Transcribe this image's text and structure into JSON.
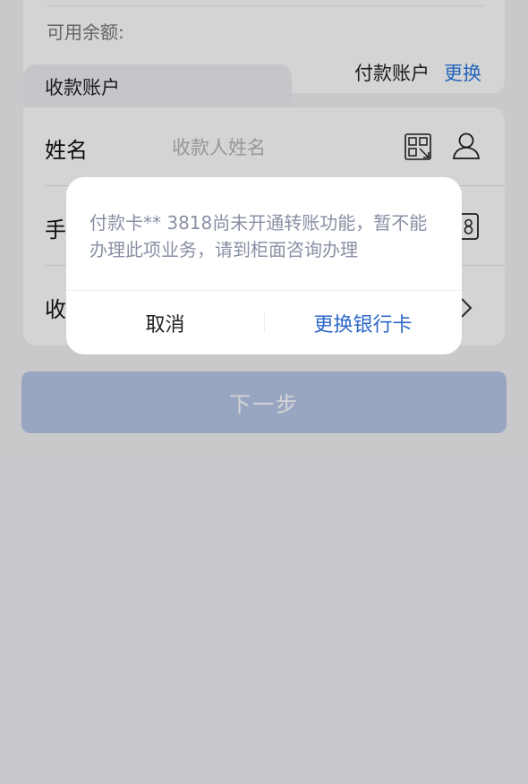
{
  "balance": {
    "label": "可用余额:"
  },
  "tabs": {
    "receive_label": "收款账户",
    "payer_label": "付款账户",
    "change_link": "更换"
  },
  "form": {
    "name_label": "姓名",
    "name_placeholder": "收款人姓名",
    "phone_label": "手",
    "bank_label": "收"
  },
  "next_button": "下一步",
  "dialog": {
    "message": "付款卡** 3818尚未开通转账功能，暂不能办理此项业务，请到柜面咨询办理",
    "cancel": "取消",
    "change_card": "更换银行卡"
  },
  "icons": {
    "scan": "ocr-scan-icon",
    "contact": "person-icon",
    "phonebook": "address-book-icon",
    "chevron": "chevron-right-icon"
  },
  "colors": {
    "accent": "#2d7be0",
    "dialog_link": "#2f68c8",
    "button_disabled": "#b9c8ea"
  }
}
